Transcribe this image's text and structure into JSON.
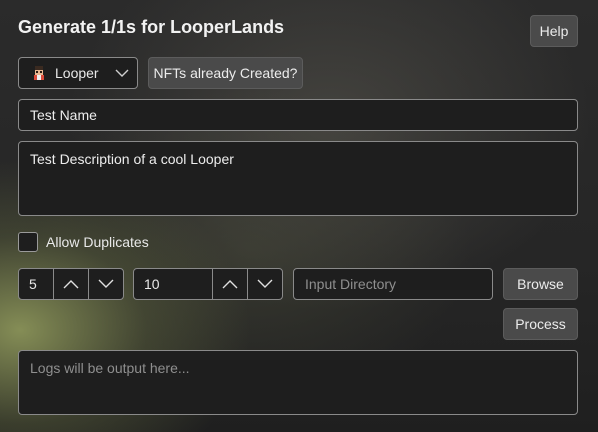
{
  "title": "Generate 1/1s for LooperLands",
  "toolbar": {
    "help_label": "Help",
    "nfts_label": "NFTs already Created?"
  },
  "character_select": {
    "selected": "Looper",
    "avatar_icon": "looper-avatar-icon"
  },
  "name_field": {
    "value": "Test Name"
  },
  "description_field": {
    "value": "Test Description of a cool Looper"
  },
  "allow_duplicates": {
    "label": "Allow Duplicates",
    "checked": false
  },
  "count_from": {
    "value": "5"
  },
  "count_to": {
    "value": "10"
  },
  "input_directory": {
    "placeholder": "Input Directory",
    "value": ""
  },
  "browse_label": "Browse",
  "process_label": "Process",
  "logs": {
    "placeholder": "Logs will be output here..."
  }
}
